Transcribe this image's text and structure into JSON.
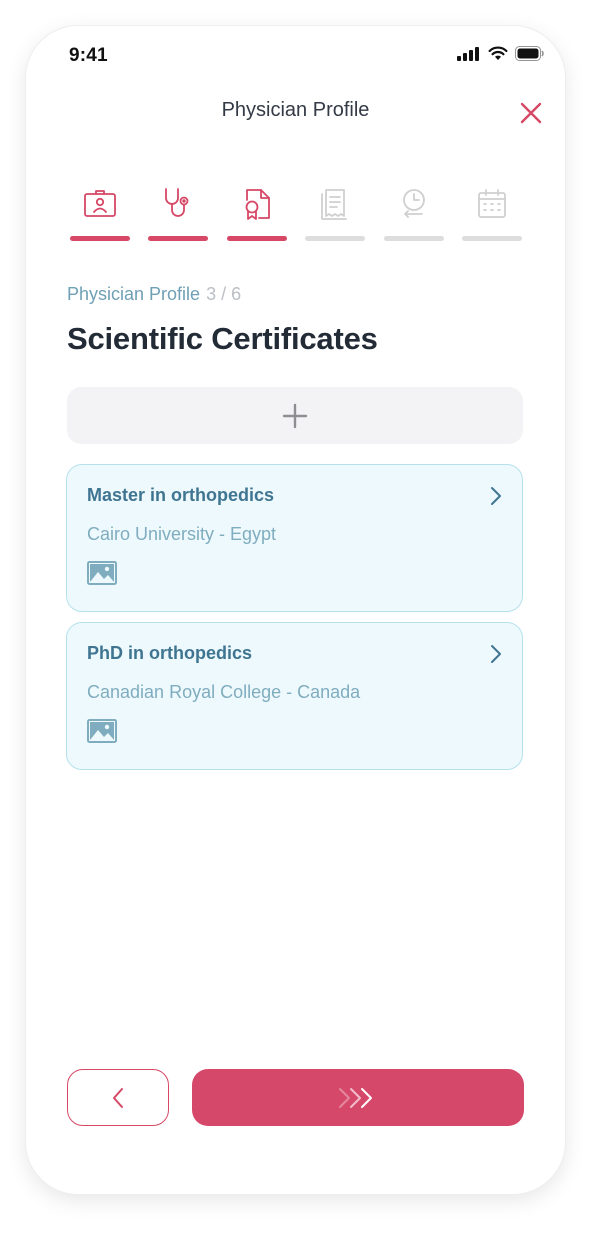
{
  "status_bar": {
    "time": "9:41"
  },
  "header": {
    "title": "Physician Profile"
  },
  "steps": [
    {
      "icon": "id-card-icon",
      "active": true
    },
    {
      "icon": "stethoscope-icon",
      "active": true
    },
    {
      "icon": "certificate-icon",
      "active": true
    },
    {
      "icon": "receipt-icon",
      "active": false
    },
    {
      "icon": "schedule-clock-icon",
      "active": false
    },
    {
      "icon": "calendar-icon",
      "active": false
    }
  ],
  "breadcrumb": {
    "section": "Physician Profile",
    "progress": "3 / 6"
  },
  "page_title": "Scientific Certificates",
  "certificates": [
    {
      "title": "Master in orthopedics",
      "institution": "Cairo University - Egypt"
    },
    {
      "title": "PhD in orthopedics",
      "institution": "Canadian Royal College - Canada"
    }
  ],
  "colors": {
    "accent": "#d6486a",
    "teal": "#3f7591",
    "card_bg": "#eef9fd"
  }
}
